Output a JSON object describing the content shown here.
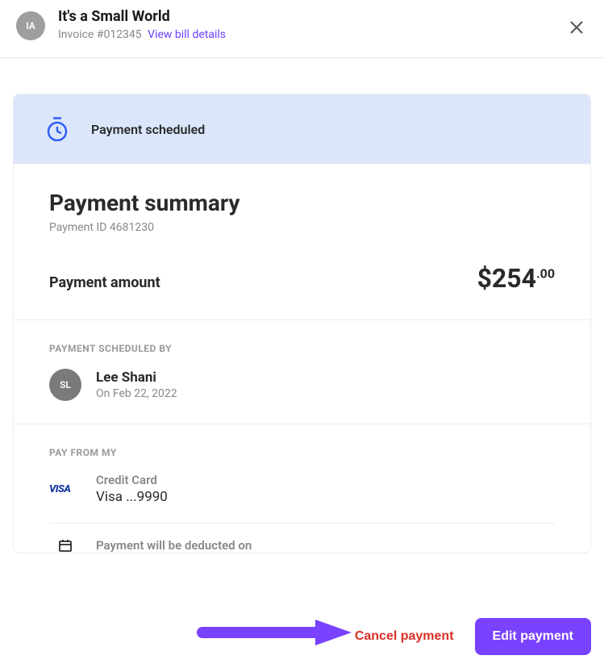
{
  "header": {
    "avatar_initials": "IA",
    "vendor_name": "It's a Small World",
    "invoice_prefix": "Invoice #",
    "invoice_number": "012345",
    "view_bill_link": "View bill details"
  },
  "status": {
    "label": "Payment scheduled"
  },
  "summary": {
    "title": "Payment summary",
    "payment_id_label": "Payment ID",
    "payment_id": "4681230",
    "amount_label": "Payment amount",
    "amount_whole": "$254",
    "amount_cents": ".00"
  },
  "scheduled_by": {
    "section_label": "PAYMENT SCHEDULED BY",
    "avatar_initials": "SL",
    "name": "Lee Shani",
    "date_prefix": "On ",
    "date": "Feb 22, 2022"
  },
  "pay_from": {
    "section_label": "PAY FROM MY",
    "visa_label": "VISA",
    "card_type": "Credit Card",
    "card_number": "Visa ...9990",
    "deduct_label": "Payment will be deducted on"
  },
  "actions": {
    "cancel_label": "Cancel payment",
    "edit_label": "Edit payment"
  }
}
